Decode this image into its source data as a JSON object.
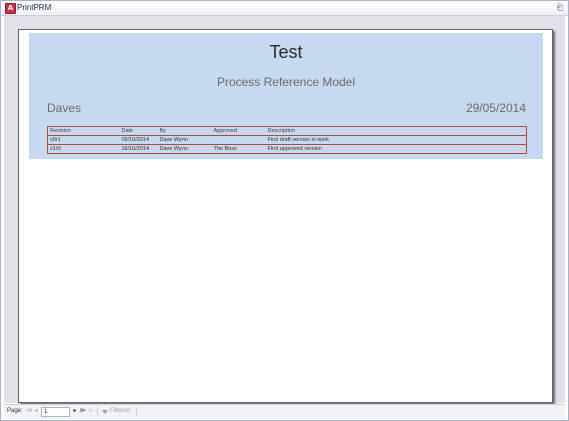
{
  "window": {
    "title": "PrintPRM",
    "app_icon": "A"
  },
  "report": {
    "title": "Test",
    "subtitle": "Process Reference Model",
    "author": "Daves",
    "date": "29/05/2014",
    "header_color": "#c6d9f1",
    "revisions": {
      "columns": [
        "Revision",
        "Date",
        "By",
        "Approved",
        "Description"
      ],
      "rows": [
        [
          "v0r1",
          "09/10/2014",
          "Dave Wynn",
          "",
          "First draft version in work"
        ],
        [
          "v1r0",
          "16/10/2014",
          "Dave Wynn",
          "The Boss",
          "First approved version"
        ]
      ]
    }
  },
  "statusbar": {
    "page_label": "Page:",
    "page_value": "1",
    "first_icon": "⧏",
    "prev_icon": "◂",
    "next_icon": "▸",
    "last_icon": "⧐",
    "new_icon": "▹",
    "filter_label": "Filtered"
  }
}
